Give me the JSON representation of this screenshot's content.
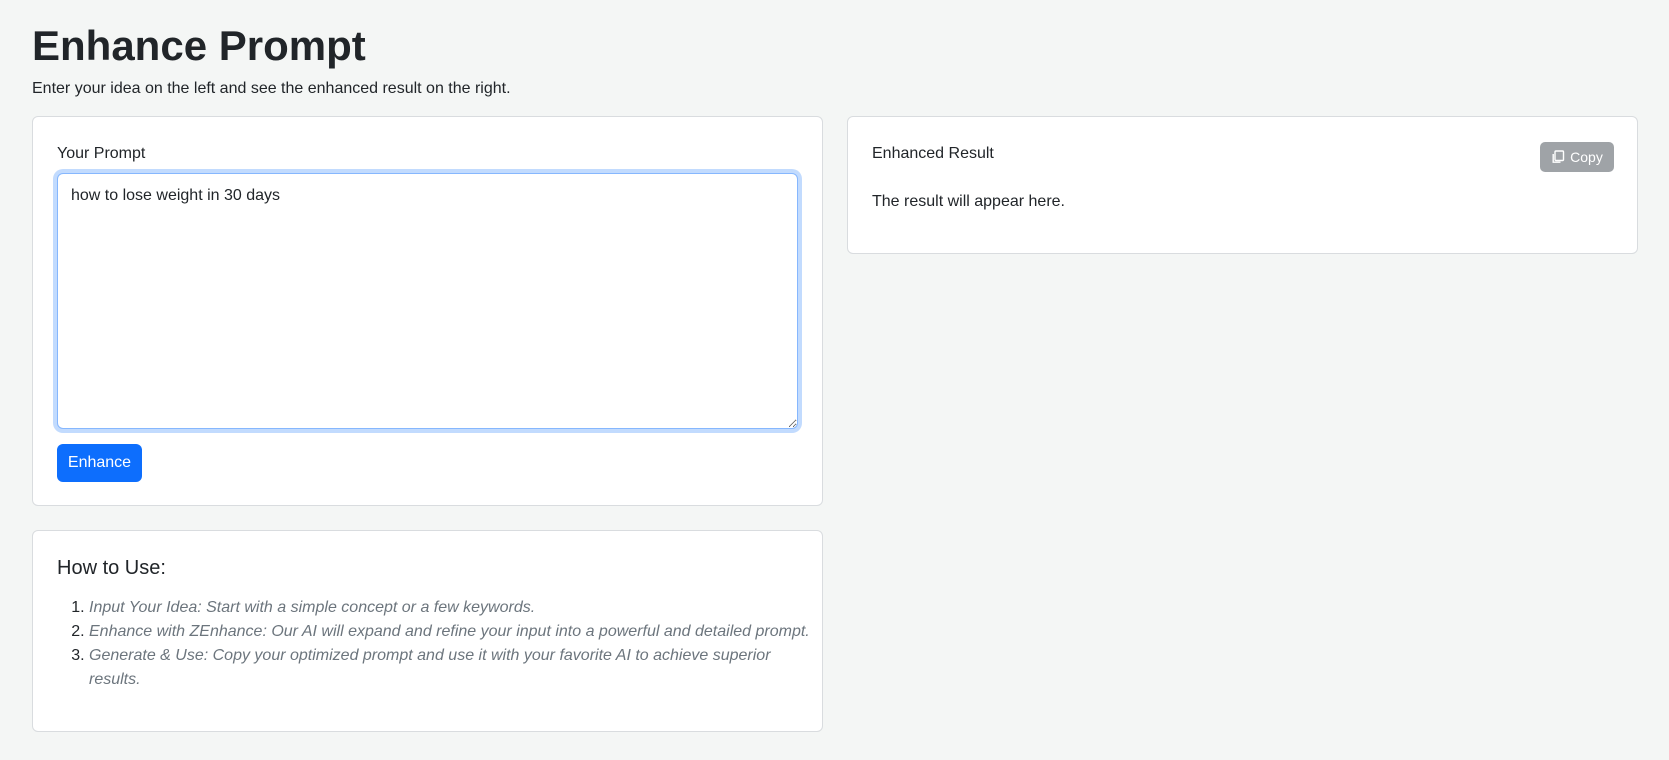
{
  "header": {
    "title": "Enhance Prompt",
    "subtitle": "Enter your idea on the left and see the enhanced result on the right."
  },
  "prompt_card": {
    "label": "Your Prompt",
    "textarea_value": "how to lose weight in 30 days",
    "enhance_label": "Enhance"
  },
  "result_card": {
    "label": "Enhanced Result",
    "copy_label": "Copy",
    "copy_icon": "copy-icon",
    "result_text": "The result will appear here."
  },
  "howto": {
    "title": "How to Use:",
    "steps": [
      "Input Your Idea: Start with a simple concept or a few keywords.",
      "Enhance with ZEnhance: Our AI will expand and refine your input into a powerful and detailed prompt.",
      "Generate & Use: Copy your optimized prompt and use it with your favorite AI to achieve superior results."
    ]
  },
  "colors": {
    "primary": "#0d6efd",
    "secondary_button": "#9fa3a7",
    "background": "#f4f6f5",
    "muted_text": "#6c757d"
  }
}
